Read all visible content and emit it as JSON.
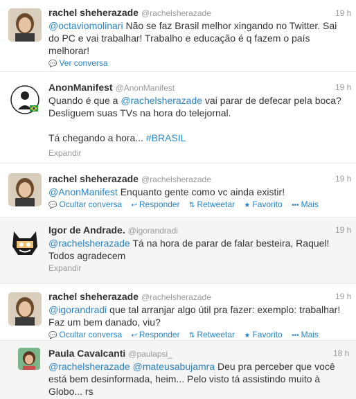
{
  "tweets": [
    {
      "name": "rachel sheherazade",
      "handle": "@rachelsherazade",
      "time": "19 h",
      "mention": "@octaviomolinari",
      "text": " Não se faz Brasil melhor xingando no Twitter. Sai\ndo PC e vai trabalhar! Trabalho e educação é q fazem o país\nmelhorar!",
      "action": "Ver conversa"
    },
    {
      "name": "AnonManifest",
      "handle": "@AnonManifest",
      "time": "19 h",
      "text_before": "Quando é que a ",
      "mention": "@rachelsherazade",
      "text_after": " vai parar de defecar pela boca?\nDesliguem suas TVs na hora do telejornal.\n\nTá chegando a hora... ",
      "hashtag": "#BRASIL",
      "expand": "Expandir"
    },
    {
      "name": "rachel sheherazade",
      "handle": "@rachelsherazade",
      "time": "19 h",
      "mention": "@AnonManifest",
      "text": " Enquanto gente como vc ainda existir!"
    },
    {
      "name": "Igor de Andrade.",
      "handle": "@igorandradi",
      "time": "19 h",
      "mention": "@rachelsherazade",
      "text": " Tá na hora de parar de falar besteira, Raquel!\nTodos agradecem",
      "expand": "Expandir"
    },
    {
      "name": "rachel sheherazade",
      "handle": "@rachelsherazade",
      "time": "19 h",
      "mention": "@igorandradi",
      "text": " que tal arranjar algo útil pra fazer: exemplo: trabalhar!\nFaz um bem danado, viu?"
    },
    {
      "name": "Paula Cavalcanti",
      "handle": "@paulapsi_",
      "time": "18 h",
      "mention1": "@rachelsherazade",
      "mention2": "@mateusabujamra",
      "text": " Deu pra perceber que você\nestá bem desinformada, heim... Pelo visto tá assistindo muito à\nGlobo... rs"
    }
  ],
  "actions": {
    "hide": "Ocultar conversa",
    "reply": "Responder",
    "retweet": "Retweetar",
    "favorite": "Favorito",
    "more": "Mais"
  },
  "colors": {
    "link": "#2a84c8",
    "muted": "#999999",
    "text": "#333333",
    "highlight_bg": "#f5f5f5"
  }
}
